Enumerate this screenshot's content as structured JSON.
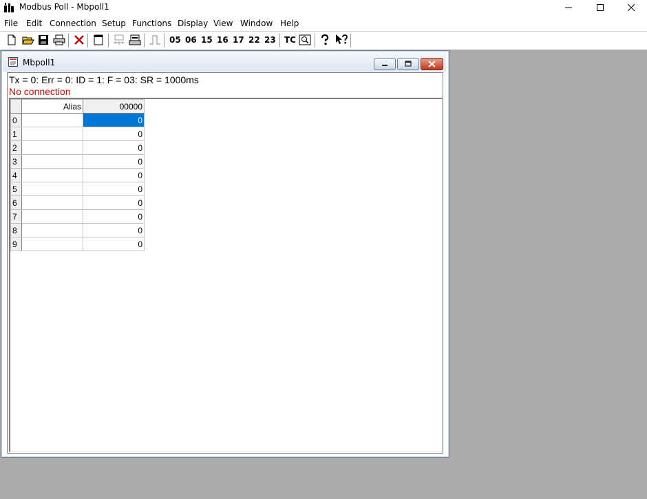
{
  "window": {
    "title": "Modbus Poll - Mbpoll1"
  },
  "menu": [
    "File",
    "Edit",
    "Connection",
    "Setup",
    "Functions",
    "Display",
    "View",
    "Window",
    "Help"
  ],
  "toolbar": {
    "function_codes": [
      "05",
      "06",
      "15",
      "16",
      "17",
      "22",
      "23"
    ],
    "tc_label": "TC"
  },
  "child": {
    "title": "Mbpoll1",
    "status_line": "Tx = 0: Err = 0: ID = 1: F = 03: SR = 1000ms",
    "connection_status": "No connection",
    "connection_color": "#e00000"
  },
  "grid": {
    "headers": [
      "Alias",
      "00000"
    ],
    "rows": [
      {
        "index": "0",
        "alias": "",
        "value": "0"
      },
      {
        "index": "1",
        "alias": "",
        "value": "0"
      },
      {
        "index": "2",
        "alias": "",
        "value": "0"
      },
      {
        "index": "3",
        "alias": "",
        "value": "0"
      },
      {
        "index": "4",
        "alias": "",
        "value": "0"
      },
      {
        "index": "5",
        "alias": "",
        "value": "0"
      },
      {
        "index": "6",
        "alias": "",
        "value": "0"
      },
      {
        "index": "7",
        "alias": "",
        "value": "0"
      },
      {
        "index": "8",
        "alias": "",
        "value": "0"
      },
      {
        "index": "9",
        "alias": "",
        "value": "0"
      }
    ],
    "selected_row": 0,
    "selection_color": "#0078d7"
  }
}
